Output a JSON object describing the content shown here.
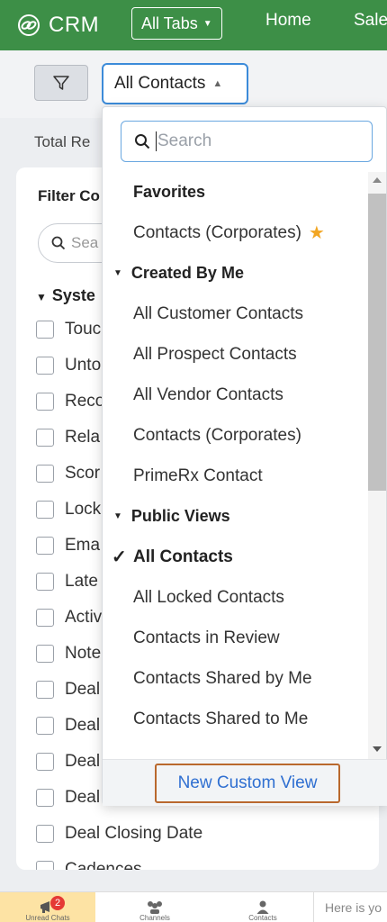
{
  "header": {
    "logo_text": "CRM",
    "all_tabs_label": "All Tabs",
    "nav": [
      "Home",
      "Sale"
    ],
    "brand_color": "#3d8f47"
  },
  "toolbar": {
    "view_selected": "All Contacts"
  },
  "content": {
    "total_records_label": "Total Re",
    "filter_title": "Filter Co",
    "filter_search_placeholder": "Sea",
    "system_section": "Syste",
    "fields": [
      "Touc",
      "Unto",
      "Reco",
      "Rela",
      "Scor",
      "Lock",
      "Ema",
      "Late",
      "Activ",
      "Note",
      "Deal",
      "Deal",
      "Deal",
      "Deal",
      "Deal Closing Date",
      "Cadences"
    ]
  },
  "dropdown": {
    "search_placeholder": "Search",
    "favorites_heading": "Favorites",
    "favorites": [
      "Contacts (Corporates)"
    ],
    "created_by_me_heading": "Created By Me",
    "created_by_me": [
      "All Customer Contacts",
      "All Prospect Contacts",
      "All Vendor Contacts",
      "Contacts (Corporates)",
      "PrimeRx Contact"
    ],
    "public_views_heading": "Public Views",
    "public_views": [
      "All Contacts",
      "All Locked Contacts",
      "Contacts in Review",
      "Contacts Shared by Me",
      "Contacts Shared to Me"
    ],
    "selected_view": "All Contacts",
    "new_custom_view_label": "New Custom View",
    "star_color": "#f2a623"
  },
  "bottombar": {
    "unread_chats_label": "Unread Chats",
    "unread_count": "2",
    "channels_label": "Channels",
    "contacts_label": "Contacts",
    "chat_placeholder": "Here is yo"
  }
}
